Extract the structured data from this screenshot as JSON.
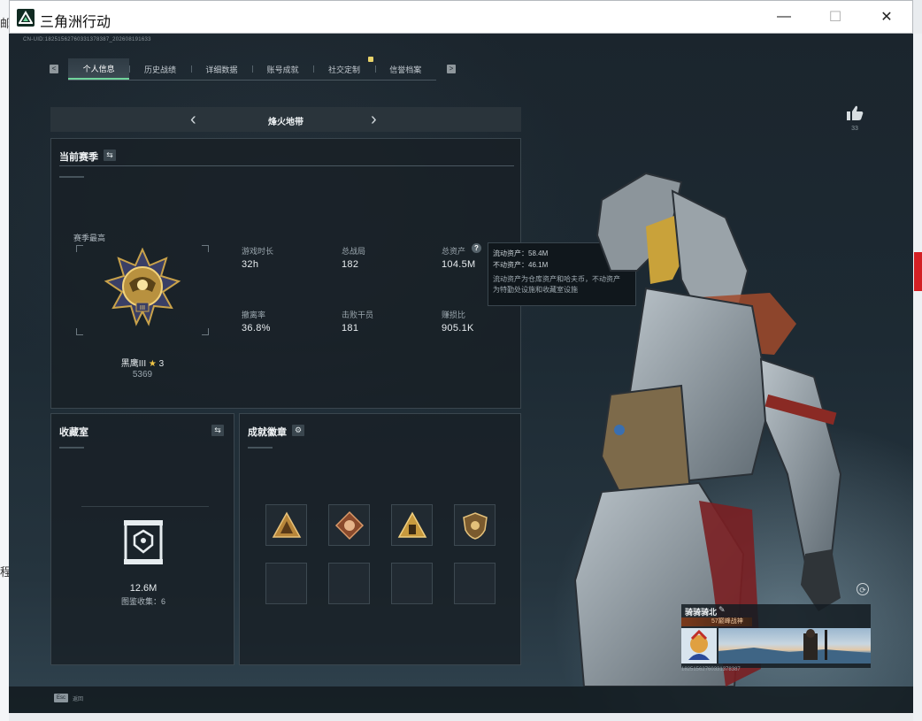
{
  "window": {
    "title": "三角洲行动",
    "minimize": "—",
    "maximize": "☐",
    "close": "✕"
  },
  "uid_text": "CN-UID:18251562760331378387_202608191633",
  "tabs": [
    {
      "label": "个人信息",
      "active": true
    },
    {
      "label": "历史战绩",
      "active": false
    },
    {
      "label": "详细数据",
      "active": false
    },
    {
      "label": "账号成就",
      "active": false
    },
    {
      "label": "社交定制",
      "active": false
    },
    {
      "label": "信誉档案",
      "active": false
    }
  ],
  "tab_nav": {
    "prev": "<",
    "next": ">"
  },
  "mode": {
    "label": "烽火地带",
    "prev": "‹",
    "next": "›"
  },
  "season": {
    "title": "当前赛季",
    "best_label": "赛季最高",
    "rank_name": "黑鹰III",
    "rank_star": "★",
    "rank_star_count": "3",
    "rank_points": "5369",
    "stats": [
      {
        "label": "游戏时长",
        "value": "32h"
      },
      {
        "label": "总战局",
        "value": "182"
      },
      {
        "label": "总资产",
        "value": "104.5M"
      },
      {
        "label": "撤离率",
        "value": "36.8%"
      },
      {
        "label": "击败干员",
        "value": "181"
      },
      {
        "label": "赚损比",
        "value": "905.1K"
      }
    ]
  },
  "asset_tooltip": {
    "liquid": "流动资产：58.4M",
    "fixed": "不动资产：46.1M",
    "desc_line1": "流动资产为仓库资产和哈夫币，不动资产",
    "desc_line2": "为特勤处设施和收藏室设施"
  },
  "collection": {
    "title": "收藏室",
    "value": "12.6M",
    "count_label": "图鉴收集：6"
  },
  "badges": {
    "title": "成就徽章"
  },
  "like": {
    "count": "33"
  },
  "player": {
    "name": "骑骑骑北",
    "rank_strip": "57巅峰战神",
    "uid": "1825156276033137838​7"
  },
  "footer": {
    "esc_key": "Esc",
    "esc_label": "返回"
  },
  "colors": {
    "accent": "#6fd39b",
    "panel": "#182026",
    "gold": "#f0c646",
    "tooltip_bg": "#10171c"
  },
  "icons": [
    "swap-icon",
    "gear-icon",
    "question-icon",
    "thumbs-up-icon",
    "refresh-icon",
    "edit-icon",
    "vault-icon"
  ]
}
